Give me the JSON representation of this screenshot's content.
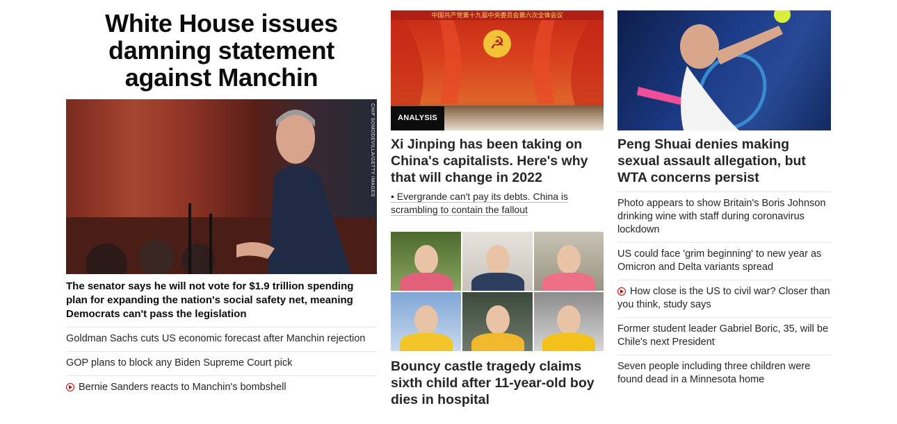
{
  "lead": {
    "title": "White House issues damning statement against Manchin",
    "photo_credit": "CHIP SOMODEVILLA/GETTY IMAGES",
    "subtitle": "The senator says he will not vote for $1.9 trillion spending plan for expanding the nation's social safety net, meaning Democrats can't pass the legislation",
    "related": [
      {
        "text": "Goldman Sachs cuts US economic forecast after Manchin rejection",
        "video": false
      },
      {
        "text": "GOP plans to block any Biden Supreme Court pick",
        "video": false
      },
      {
        "text": "Bernie Sanders reacts to Manchin's bombshell",
        "video": true
      }
    ]
  },
  "xi_story": {
    "banner": "中国共产党第十九届中央委员会第六次全体会议",
    "badge": "ANALYSIS",
    "title": "Xi Jinping has been taking on China's capitalists. Here's why that will change in 2022",
    "bullet": "• Evergrande can't pay its debts. China is scrambling to contain the fallout"
  },
  "bouncy_story": {
    "title": "Bouncy castle tragedy claims sixth child after 11-year-old boy dies in hospital"
  },
  "peng_story": {
    "title": "Peng Shuai denies making sexual assault allegation, but WTA concerns persist",
    "related": [
      {
        "text": "Photo appears to show Britain's Boris Johnson drinking wine with staff during coronavirus lockdown",
        "video": false
      },
      {
        "text": "US could face 'grim beginning' to new year as Omicron and Delta variants spread",
        "video": false
      },
      {
        "text": "How close is the US to civil war? Closer than you think, study says",
        "video": true
      },
      {
        "text": "Former student leader Gabriel Boric, 35, will be Chile's next President",
        "video": false
      },
      {
        "text": "Seven people including three children were found dead in a Minnesota home",
        "video": false
      }
    ]
  },
  "colors": {
    "text": "#0c0c0c",
    "secondary_text": "#262626",
    "video_red": "#cc0000",
    "badge_bg": "#0c0c0c",
    "divider": "#e6e6e6"
  }
}
